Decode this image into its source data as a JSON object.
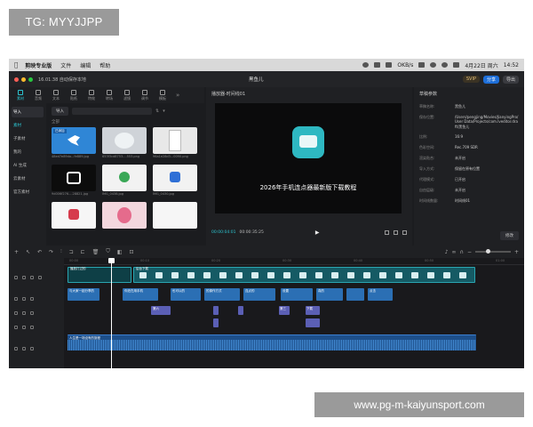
{
  "watermark_top": "TG: MYYJJPP",
  "watermark_bottom": "www.pg-m-kaiyunsport.com",
  "menubar": {
    "app": "剪映专业版",
    "items": [
      "文件",
      "编辑",
      "帮助"
    ],
    "date": "4月22日 周六",
    "time": "14:52",
    "net": "OKB/s"
  },
  "titlebar": {
    "left": "16.01.38 自动保存本地",
    "center": "黑鱼儿",
    "vip": "SVIP",
    "share": "分享",
    "export": "导出"
  },
  "toolbar": {
    "items": [
      {
        "label": "素材",
        "active": true
      },
      {
        "label": "音频"
      },
      {
        "label": "文本"
      },
      {
        "label": "贴纸"
      },
      {
        "label": "特效"
      },
      {
        "label": "转场"
      },
      {
        "label": "滤镜"
      },
      {
        "label": "调节"
      },
      {
        "label": "模板"
      }
    ]
  },
  "leftnav": [
    {
      "label": "导入",
      "state": "sel"
    },
    {
      "label": "素材",
      "state": "acc"
    },
    {
      "label": "子素材"
    },
    {
      "label": "我的"
    },
    {
      "label": "AI 生成"
    },
    {
      "label": "云素材"
    },
    {
      "label": "官方素材"
    }
  ],
  "media": {
    "import_label": "导入",
    "all_label": "全部",
    "thumbs": [
      {
        "name": "48ed7e89da...fe889.jpg",
        "color": "#2f86d6",
        "badge": "已添加"
      },
      {
        "name": "653f3cd8753....553.png",
        "color": "#cfd3d8"
      },
      {
        "name": "96a1e28d3...0090.png",
        "color": "#e8e8e8"
      },
      {
        "name": "9d006f276....28821.jpg",
        "color": "#0c0c0c"
      },
      {
        "name": "IMG_0438.jpg",
        "color": "#f2f2f2"
      },
      {
        "name": "IMG_0430.jpg",
        "color": "#f2f2f2"
      },
      {
        "name": "",
        "color": "#f6f6f6"
      },
      {
        "name": "",
        "color": "#f3d7de"
      },
      {
        "name": "",
        "color": "#f6f6f6"
      }
    ]
  },
  "player": {
    "title": "播放器-时间线01",
    "video_title": "2026年手机连点器最新版下载教程",
    "time_current": "00:00:04:01",
    "time_total": "00:00:35:25"
  },
  "props": {
    "title": "草稿参数",
    "rows": [
      {
        "k": "草稿名称:",
        "v": "黑鱼儿"
      },
      {
        "k": "保存位置:",
        "v": "/Users/pengjing/Movies/JianyingPro/User Data/Projects/com.lveditor.draft/黑鱼儿"
      },
      {
        "k": "比例:",
        "v": "16:9"
      },
      {
        "k": "色彩空间:",
        "v": "Rec.709 SDR"
      },
      {
        "k": "渲染贴合:",
        "v": "未开启"
      },
      {
        "k": "导入方式:",
        "v": "保留在原有位置"
      },
      {
        "k": "代理模式:",
        "v": "已开启"
      },
      {
        "k": "自由层级:",
        "v": "未开启"
      },
      {
        "k": "时间线数量:",
        "v": "时间线01"
      }
    ],
    "modify": "修改"
  },
  "timeline": {
    "ruler": [
      "00:00",
      "00:10",
      "00:20",
      "00:30",
      "00:40",
      "00:50",
      "01:00"
    ],
    "video_track_label": "播放打过的",
    "video_clip_name": "后台下载",
    "text_clips": [
      "与大家一起分享的",
      "你还在用手机",
      "也可以的",
      "的操作方式",
      "连点的",
      "设置",
      "真的",
      "点击"
    ],
    "sticker_clips": [
      "第六",
      "第三",
      "下载"
    ],
    "audio_clip_name": "人生是一场没有的旅程"
  }
}
